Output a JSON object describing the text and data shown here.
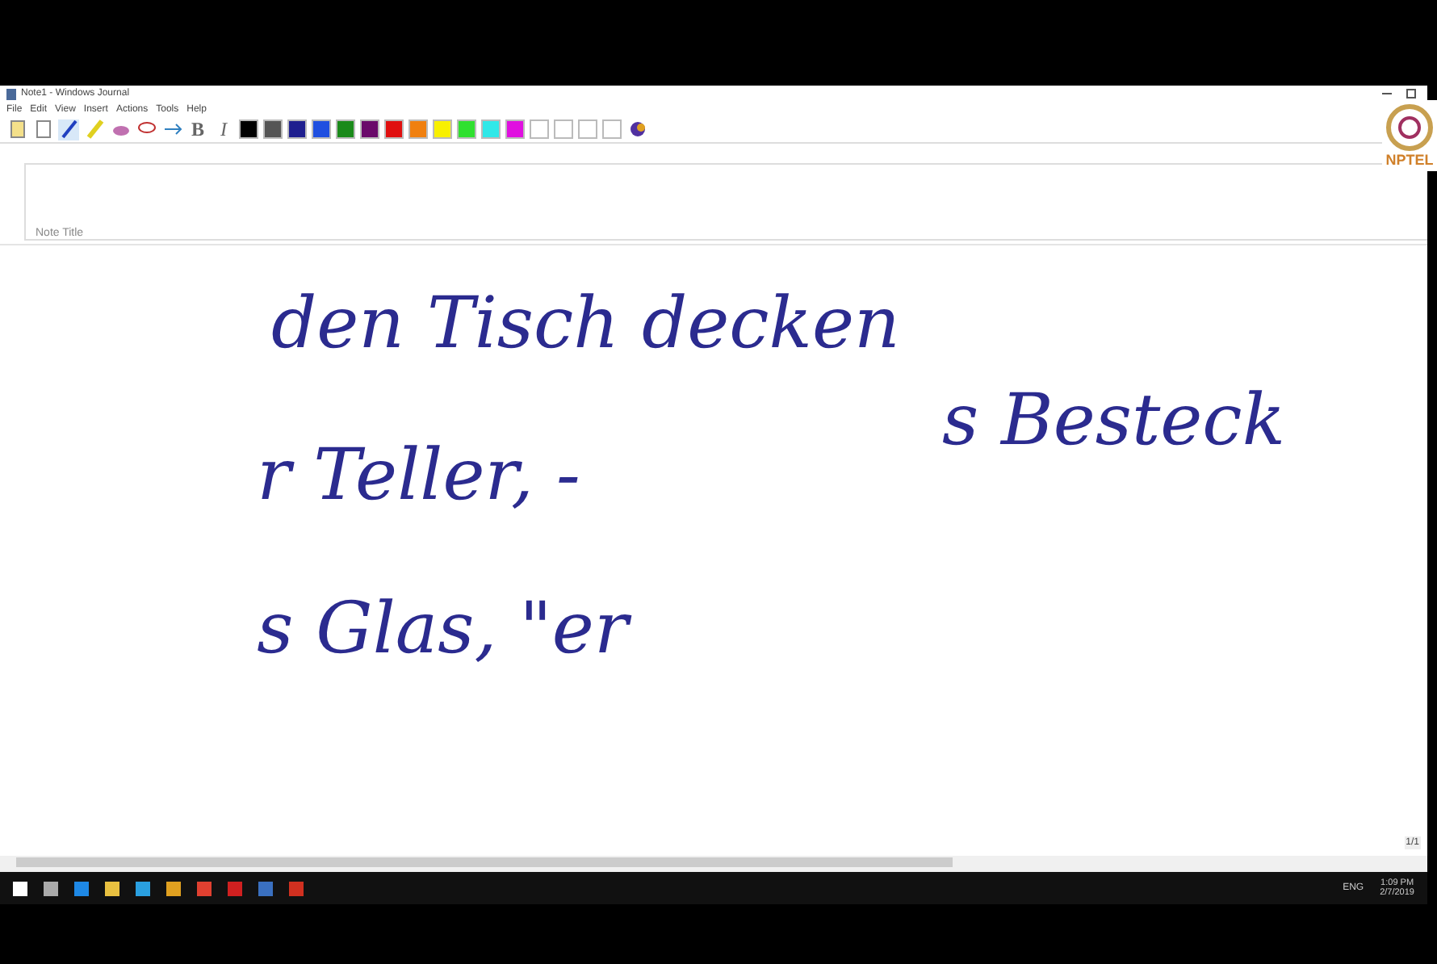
{
  "window": {
    "title": "Note1 - Windows Journal"
  },
  "menu": [
    "File",
    "Edit",
    "View",
    "Insert",
    "Actions",
    "Tools",
    "Help"
  ],
  "toolbar": {
    "bold": "B",
    "italic": "I",
    "colors": [
      {
        "color": "#000000"
      },
      {
        "color": "#555555"
      },
      {
        "color": "#1f1f8f"
      },
      {
        "color": "#1f4fe0"
      },
      {
        "color": "#1a8a1a"
      },
      {
        "color": "#6a0a6a"
      },
      {
        "color": "#e01010"
      },
      {
        "color": "#f08010"
      },
      {
        "color": "#f8f000"
      },
      {
        "color": "#30e030"
      },
      {
        "color": "#30e8e8"
      },
      {
        "color": "#e010e0"
      },
      {
        "color": "#ffffff"
      },
      {
        "color": "#ffffff"
      },
      {
        "color": "#ffffff"
      },
      {
        "color": "#ffffff"
      }
    ]
  },
  "logo": {
    "text": "NPTEL"
  },
  "note": {
    "title_placeholder": "Note Title",
    "ink": [
      {
        "text": "den Tisch decken"
      },
      {
        "text": "s Besteck"
      },
      {
        "text": "r Teller, -"
      },
      {
        "text": "s Glas, \"er"
      }
    ]
  },
  "page_counter": "1/1",
  "taskbar": {
    "apps": [
      {
        "color": "#ffffff"
      },
      {
        "color": "#aaaaaa"
      },
      {
        "color": "#1e88e5"
      },
      {
        "color": "#e8c040"
      },
      {
        "color": "#2aa0e0"
      },
      {
        "color": "#e0a020"
      },
      {
        "color": "#e04030"
      },
      {
        "color": "#d02020"
      },
      {
        "color": "#3a70c0"
      },
      {
        "color": "#d03020"
      }
    ],
    "language": "ENG",
    "time": "1:09 PM",
    "date": "2/7/2019"
  }
}
